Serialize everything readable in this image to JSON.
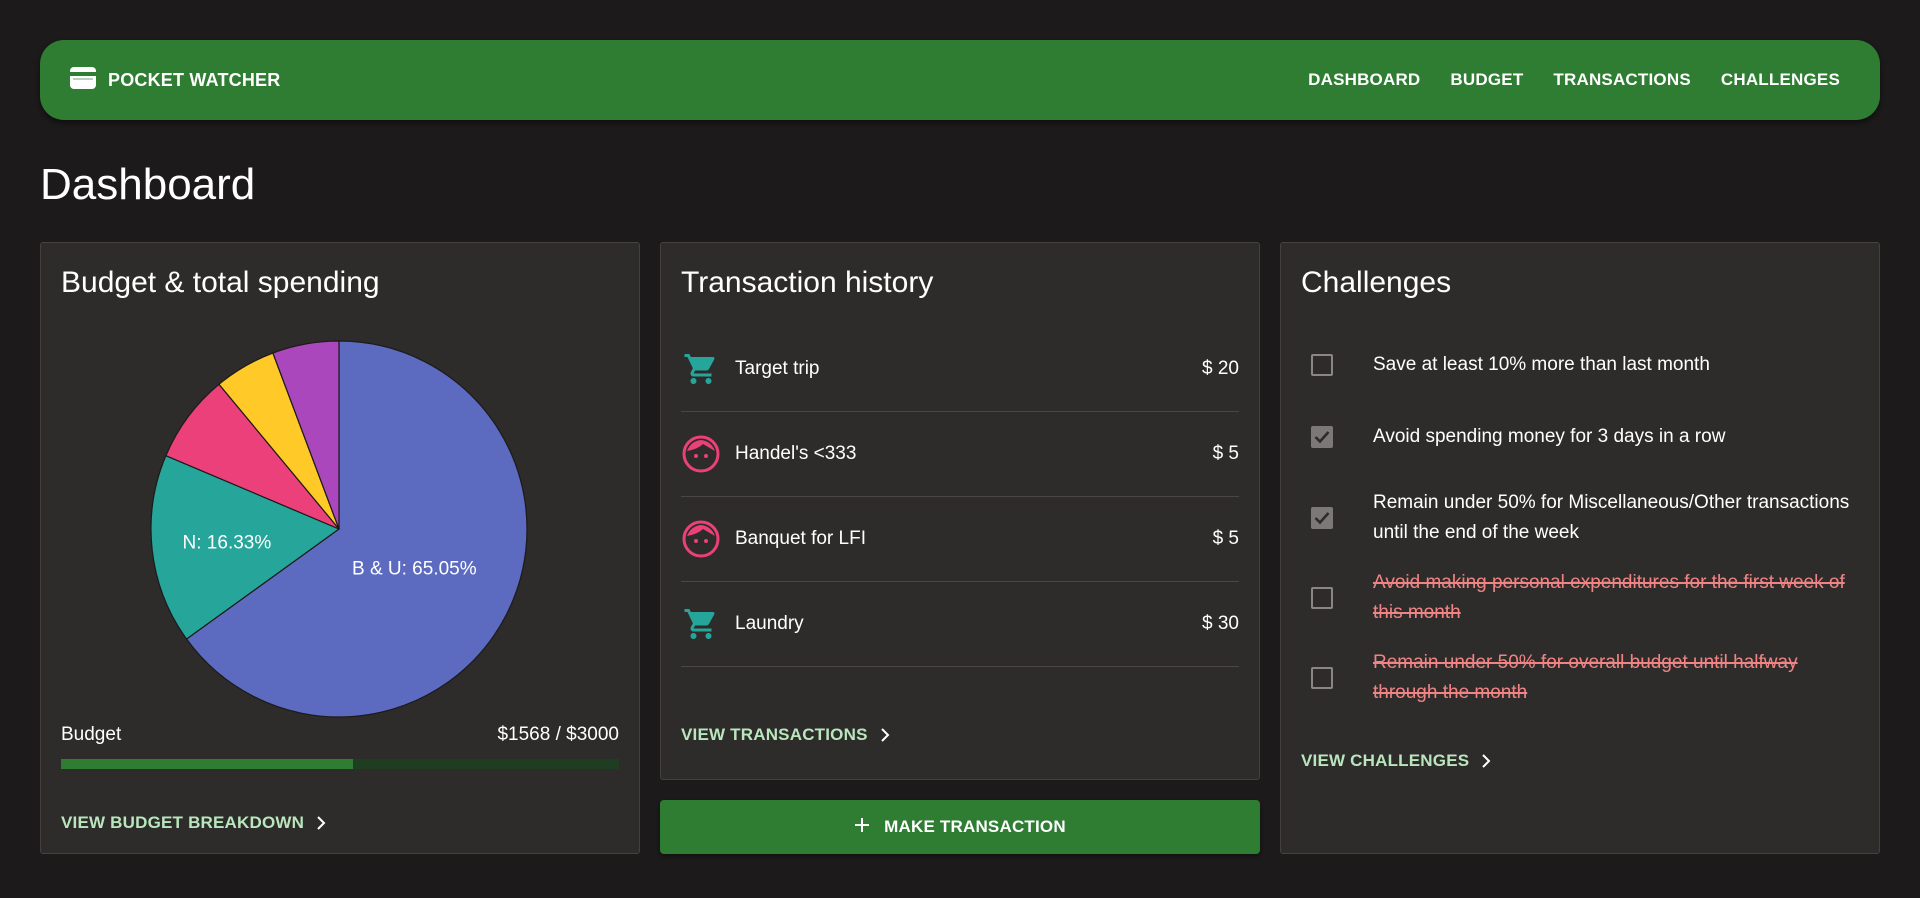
{
  "header": {
    "brand": "POCKET WATCHER",
    "brand_icon": "wallet-icon",
    "nav": [
      "DASHBOARD",
      "BUDGET",
      "TRANSACTIONS",
      "CHALLENGES"
    ]
  },
  "page": {
    "title": "Dashboard"
  },
  "budget_card": {
    "title": "Budget & total spending",
    "budget_label": "Budget",
    "budget_amount": "$1568 / $3000",
    "budget_spent": 1568,
    "budget_total": 3000,
    "view_label": "VIEW BUDGET BREAKDOWN"
  },
  "chart_data": {
    "type": "pie",
    "labels": [
      "B & U: 65.05%",
      "N: 16.33%"
    ],
    "values": [
      65.05,
      16.33,
      7.6,
      5.3,
      5.72
    ],
    "colors": [
      "#5c6bc0",
      "#26a69a",
      "#ec407a",
      "#ffca28",
      "#ab47bc"
    ]
  },
  "transactions_card": {
    "title": "Transaction history",
    "items": [
      {
        "name": "Target trip",
        "amount": "$ 20",
        "icon": "shopping-cart-icon"
      },
      {
        "name": "Handel's <333",
        "amount": "$ 5",
        "icon": "face-icon"
      },
      {
        "name": "Banquet for LFI",
        "amount": "$ 5",
        "icon": "face-icon"
      },
      {
        "name": "Laundry",
        "amount": "$ 30",
        "icon": "shopping-cart-icon"
      }
    ],
    "view_label": "VIEW TRANSACTIONS",
    "make_label": "MAKE TRANSACTION"
  },
  "challenges_card": {
    "title": "Challenges",
    "items": [
      {
        "text": "Save at least 10% more than last month",
        "checked": false,
        "struck": false
      },
      {
        "text": "Avoid spending money for 3 days in a row",
        "checked": true,
        "struck": false
      },
      {
        "text": "Remain under 50% for Miscellaneous/Other transactions until the end of the week",
        "checked": true,
        "struck": false
      },
      {
        "text": "Avoid making personal expenditures for the first week of this month",
        "checked": false,
        "struck": true
      },
      {
        "text": "Remain under 50% for overall budget until halfway through the month",
        "checked": false,
        "struck": true
      }
    ],
    "view_label": "VIEW CHALLENGES"
  },
  "colors": {
    "background": "#1c1a1a",
    "card": "#2e2b2b",
    "primary": "#2e7d32",
    "link": "#b9e6bc",
    "cart": "#26a69a",
    "face": "#ec407a",
    "struck_text": "#f08484"
  }
}
